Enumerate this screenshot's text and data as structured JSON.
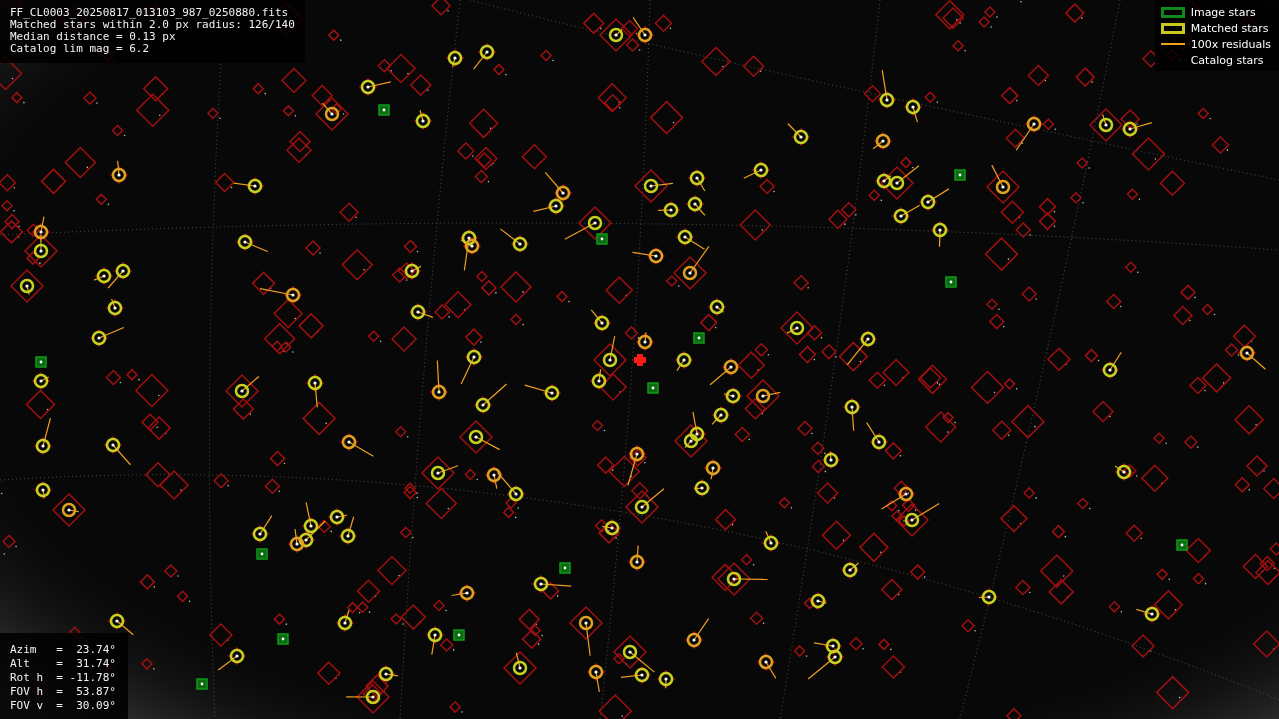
{
  "info": {
    "filename": "FF_CL0003_20250817_013103_987_0250880.fits",
    "lines": [
      "Matched stars within 2.0 px radius: 126/140",
      "Median distance = 0.13 px",
      "Catalog lim mag = 6.2"
    ]
  },
  "legend": [
    {
      "label": "Image stars",
      "kind": "box",
      "color": "#0f8a1a"
    },
    {
      "label": "Matched stars",
      "kind": "box",
      "color": "#c8c81e"
    },
    {
      "label": "100x residuals",
      "kind": "line",
      "color": "#f0a020"
    },
    {
      "label": "Catalog stars",
      "kind": "none"
    }
  ],
  "pointing": [
    "Azim   =  23.74°",
    "Alt    =  31.74°",
    "Rot h  = -11.78°",
    "FOV h  =  53.87°",
    "FOV v  =  30.09°"
  ]
}
